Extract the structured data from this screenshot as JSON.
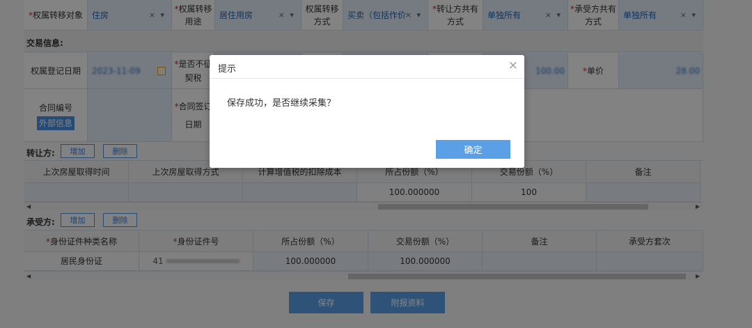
{
  "row1": {
    "target_label": "权属转移对象",
    "target_value": "住房",
    "use_label_1": "权属转移",
    "use_label_2": "用途",
    "use_value": "居住用房",
    "method_label_1": "权属转移",
    "method_label_2": "方式",
    "method_value": "买卖（包括作价",
    "transferor_share_1": "转让方共有",
    "transferor_share_2": "方式",
    "transferor_share_value": "单独所有",
    "transferee_share_1": "承受方共有",
    "transferee_share_2": "方式",
    "transferee_share_value": "单独所有"
  },
  "select_icon": "× ▾",
  "trade_section": "交易信息:",
  "row2": {
    "reg_date_label": "权属登记日期",
    "reg_date_value": "2023-11-09",
    "tax_label_1": "是否不征",
    "tax_label_2": "契税",
    "amount_value": "100.00",
    "unit_price_label": "单价",
    "unit_price_value": "28.00"
  },
  "row3": {
    "contract_label": "合同编号",
    "external_info": "外部信息",
    "sign_label_1": "合同签订",
    "sign_label_2": "日期"
  },
  "transferor": {
    "title": "转让方:",
    "add": "增加",
    "delete": "删除",
    "headers": [
      "上次房屋取得时间",
      "上次房屋取得方式",
      "计算增值税的扣除成本",
      "所占份额（%）",
      "交易份额（%）",
      "备注"
    ],
    "row": [
      "",
      "",
      "",
      "100.000000",
      "100",
      ""
    ]
  },
  "transferee": {
    "title": "承受方:",
    "add": "增加",
    "delete": "删除",
    "headers": [
      "身份证件种类名称",
      "身份证件号",
      "所占份额（%）",
      "交易份额（%）",
      "备注",
      "承受方套次"
    ],
    "row": [
      "居民身份证",
      "41",
      "100.000000",
      "100.000000",
      "",
      ""
    ]
  },
  "buttons": {
    "save": "保存",
    "attach": "附报资料"
  },
  "dialog": {
    "title": "提示",
    "close": "×",
    "message": "保存成功，是否继续采集？",
    "confirm": "确定"
  },
  "colors": {
    "primary": "#5b9fe6",
    "required": "#e02020",
    "input_bg": "#e3ecf8"
  }
}
